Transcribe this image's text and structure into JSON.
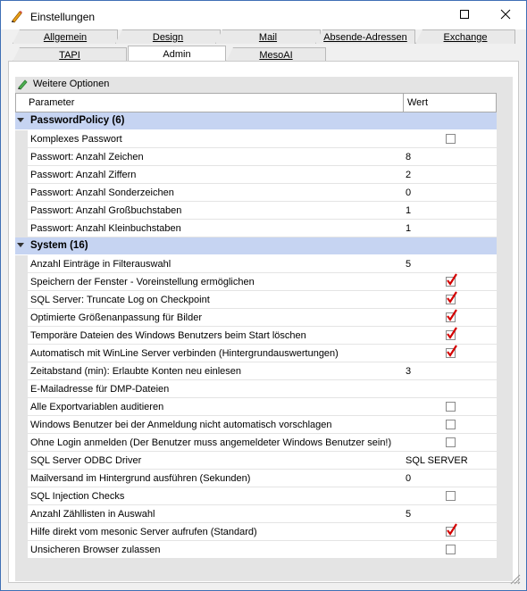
{
  "window": {
    "title": "Einstellungen"
  },
  "tabs": {
    "row1": [
      {
        "label": "Allgemein"
      },
      {
        "label": "Design"
      },
      {
        "label": "Mail"
      },
      {
        "label": "Absende-Adressen"
      },
      {
        "label": "Exchange"
      }
    ],
    "row2": [
      {
        "label": "TAPI"
      },
      {
        "label": "Admin",
        "active": true
      },
      {
        "label": "MesoAI"
      }
    ]
  },
  "section": {
    "title": "Weitere Optionen"
  },
  "grid": {
    "col_param": "Parameter",
    "col_value": "Wert",
    "groups": [
      {
        "title": "PasswordPolicy (6)",
        "rows": [
          {
            "name": "Komplexes Passwort",
            "type": "checkbox",
            "checked": false
          },
          {
            "name": "Passwort: Anzahl Zeichen",
            "type": "text",
            "value": "8"
          },
          {
            "name": "Passwort: Anzahl Ziffern",
            "type": "text",
            "value": "2"
          },
          {
            "name": "Passwort: Anzahl Sonderzeichen",
            "type": "text",
            "value": "0"
          },
          {
            "name": "Passwort: Anzahl Großbuchstaben",
            "type": "text",
            "value": "1"
          },
          {
            "name": "Passwort: Anzahl Kleinbuchstaben",
            "type": "text",
            "value": "1"
          }
        ]
      },
      {
        "title": "System (16)",
        "rows": [
          {
            "name": "Anzahl Einträge in Filterauswahl",
            "type": "text",
            "value": "5"
          },
          {
            "name": "Speichern der Fenster - Voreinstellung ermöglichen",
            "type": "checkbox",
            "checked": true
          },
          {
            "name": "SQL Server: Truncate Log on Checkpoint",
            "type": "checkbox",
            "checked": true
          },
          {
            "name": "Optimierte Größenanpassung für Bilder",
            "type": "checkbox",
            "checked": true
          },
          {
            "name": "Temporäre Dateien des Windows Benutzers beim Start löschen",
            "type": "checkbox",
            "checked": true
          },
          {
            "name": "Automatisch mit WinLine Server verbinden (Hintergrundauswertungen)",
            "type": "checkbox",
            "checked": true
          },
          {
            "name": "Zeitabstand (min): Erlaubte Konten neu einlesen",
            "type": "text",
            "value": "3"
          },
          {
            "name": "E-Mailadresse für DMP-Dateien",
            "type": "text",
            "value": ""
          },
          {
            "name": "Alle Exportvariablen auditieren",
            "type": "checkbox",
            "checked": false
          },
          {
            "name": "Windows Benutzer bei der Anmeldung nicht automatisch vorschlagen",
            "type": "checkbox",
            "checked": false
          },
          {
            "name": "Ohne Login anmelden (Der Benutzer muss angemeldeter Windows Benutzer sein!)",
            "type": "checkbox",
            "checked": false
          },
          {
            "name": "SQL Server ODBC Driver",
            "type": "text",
            "value": "SQL SERVER"
          },
          {
            "name": "Mailversand im Hintergrund ausführen (Sekunden)",
            "type": "text",
            "value": "0"
          },
          {
            "name": "SQL Injection Checks",
            "type": "checkbox",
            "checked": false
          },
          {
            "name": "Anzahl Zähllisten in Auswahl",
            "type": "text",
            "value": "5"
          },
          {
            "name": "Hilfe direkt vom mesonic Server aufrufen (Standard)",
            "type": "checkbox",
            "checked": true
          },
          {
            "name": "Unsicheren Browser zulassen",
            "type": "checkbox",
            "checked": false
          }
        ]
      }
    ]
  },
  "colors": {
    "group_bg": "#c6d4f2",
    "check_red": "#d40000",
    "accent": "#3f6fb5"
  }
}
